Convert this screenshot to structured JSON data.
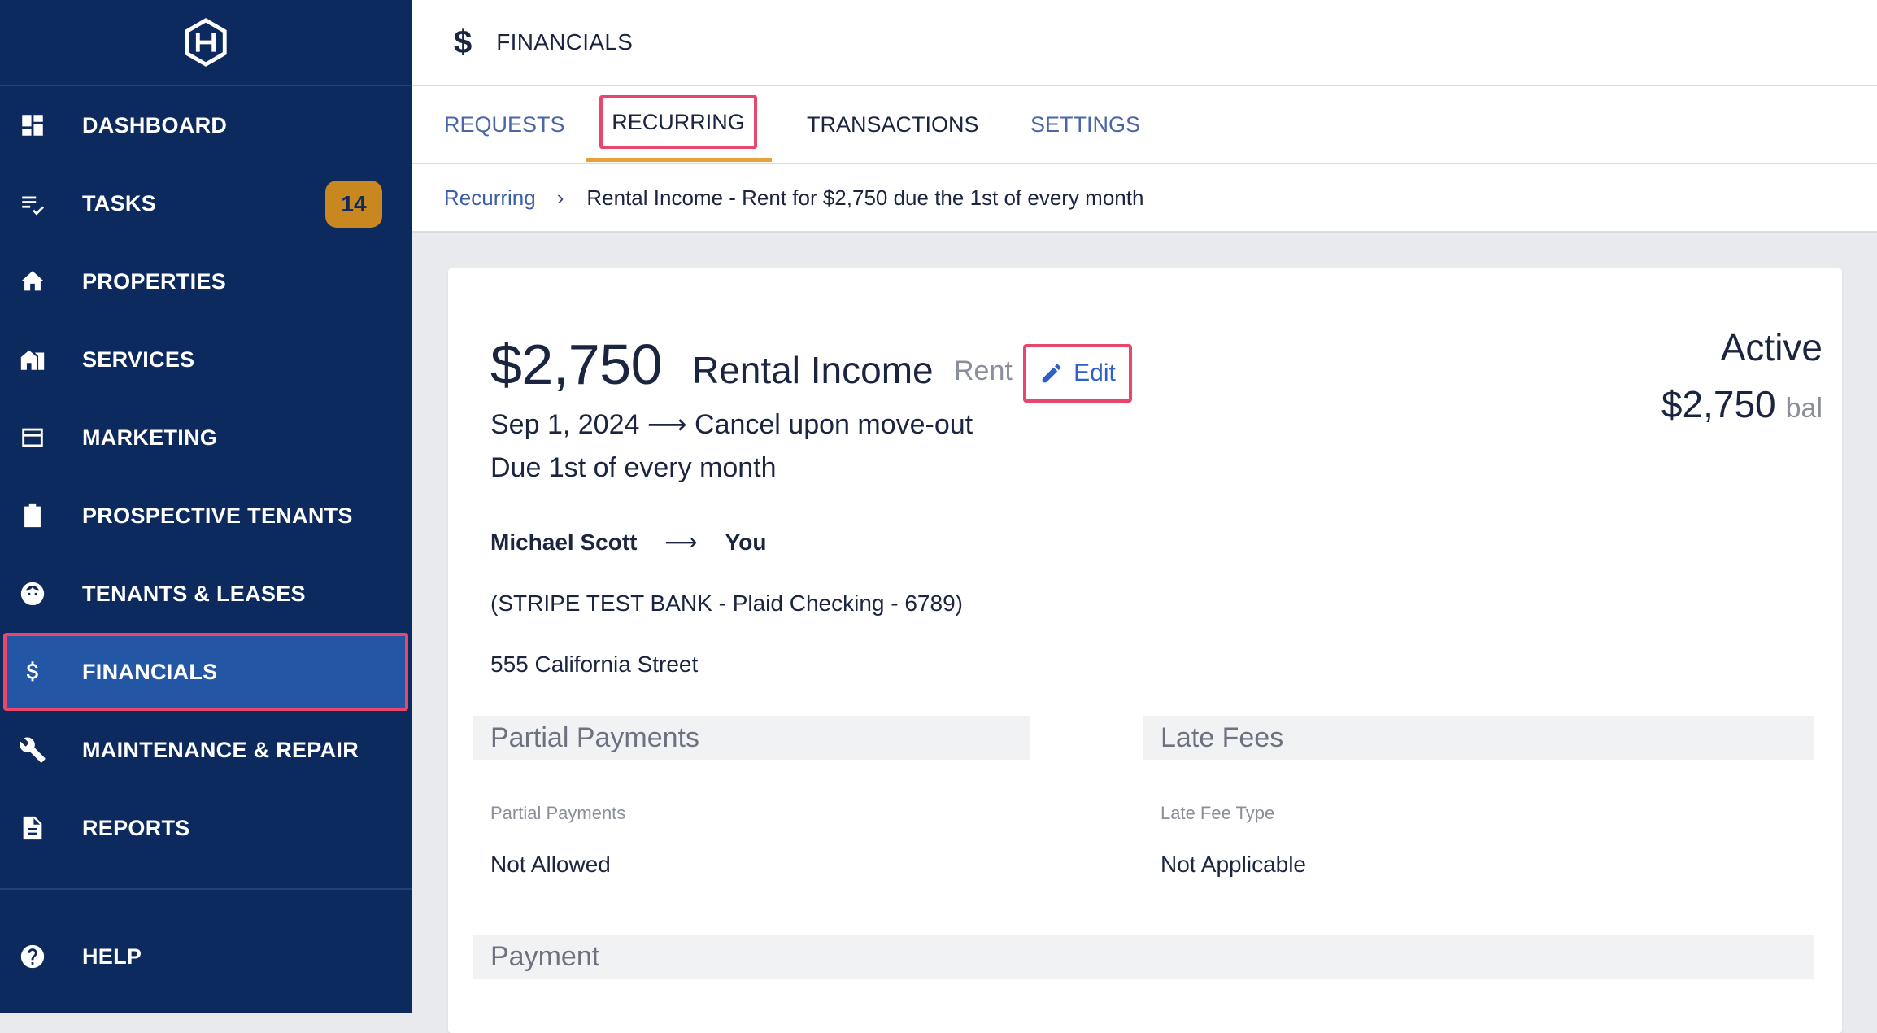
{
  "sidebar": {
    "logo": "H",
    "items": [
      {
        "label": "DASHBOARD",
        "icon": "dashboard-icon"
      },
      {
        "label": "TASKS",
        "icon": "tasks-icon",
        "badge": "14"
      },
      {
        "label": "PROPERTIES",
        "icon": "home-icon"
      },
      {
        "label": "SERVICES",
        "icon": "services-icon"
      },
      {
        "label": "MARKETING",
        "icon": "marketing-icon"
      },
      {
        "label": "PROSPECTIVE TENANTS",
        "icon": "clipboard-icon"
      },
      {
        "label": "TENANTS & LEASES",
        "icon": "face-icon"
      },
      {
        "label": "FINANCIALS",
        "icon": "dollar-icon"
      },
      {
        "label": "MAINTENANCE & REPAIR",
        "icon": "wrench-icon"
      },
      {
        "label": "REPORTS",
        "icon": "report-icon"
      }
    ],
    "help": {
      "label": "HELP",
      "icon": "help-icon"
    }
  },
  "header": {
    "icon": "$",
    "title": "FINANCIALS"
  },
  "tabs": [
    {
      "label": "REQUESTS"
    },
    {
      "label": "RECURRING"
    },
    {
      "label": "TRANSACTIONS"
    },
    {
      "label": "SETTINGS"
    }
  ],
  "breadcrumb": {
    "parent": "Recurring",
    "separator": "›",
    "current": "Rental Income - Rent for $2,750 due the 1st of every month"
  },
  "detail": {
    "amount": "$2,750",
    "category": "Rental Income",
    "subcategory": "Rent",
    "edit_label": "Edit",
    "status": "Active",
    "balance": "$2,750",
    "balance_suffix": "bal",
    "date_range": "Sep 1, 2024 ⟶ Cancel upon move-out",
    "schedule": "Due 1st of every month",
    "payer": "Michael Scott",
    "arrow": "⟶",
    "payee": "You",
    "bank": "(STRIPE TEST BANK - Plaid Checking - 6789)",
    "address": "555 California Street"
  },
  "sections": {
    "partial_payments": {
      "title": "Partial Payments",
      "field_label": "Partial Payments",
      "field_value": "Not Allowed"
    },
    "late_fees": {
      "title": "Late Fees",
      "field_label": "Late Fee Type",
      "field_value": "Not Applicable"
    },
    "payment": {
      "title": "Payment"
    }
  },
  "colors": {
    "sidebar_bg": "#0d2a5e",
    "sidebar_active": "#2456a6",
    "highlight": "#e8476b",
    "badge": "#c8881f",
    "tab_underline": "#e8a23a",
    "link": "#2f60c8"
  }
}
